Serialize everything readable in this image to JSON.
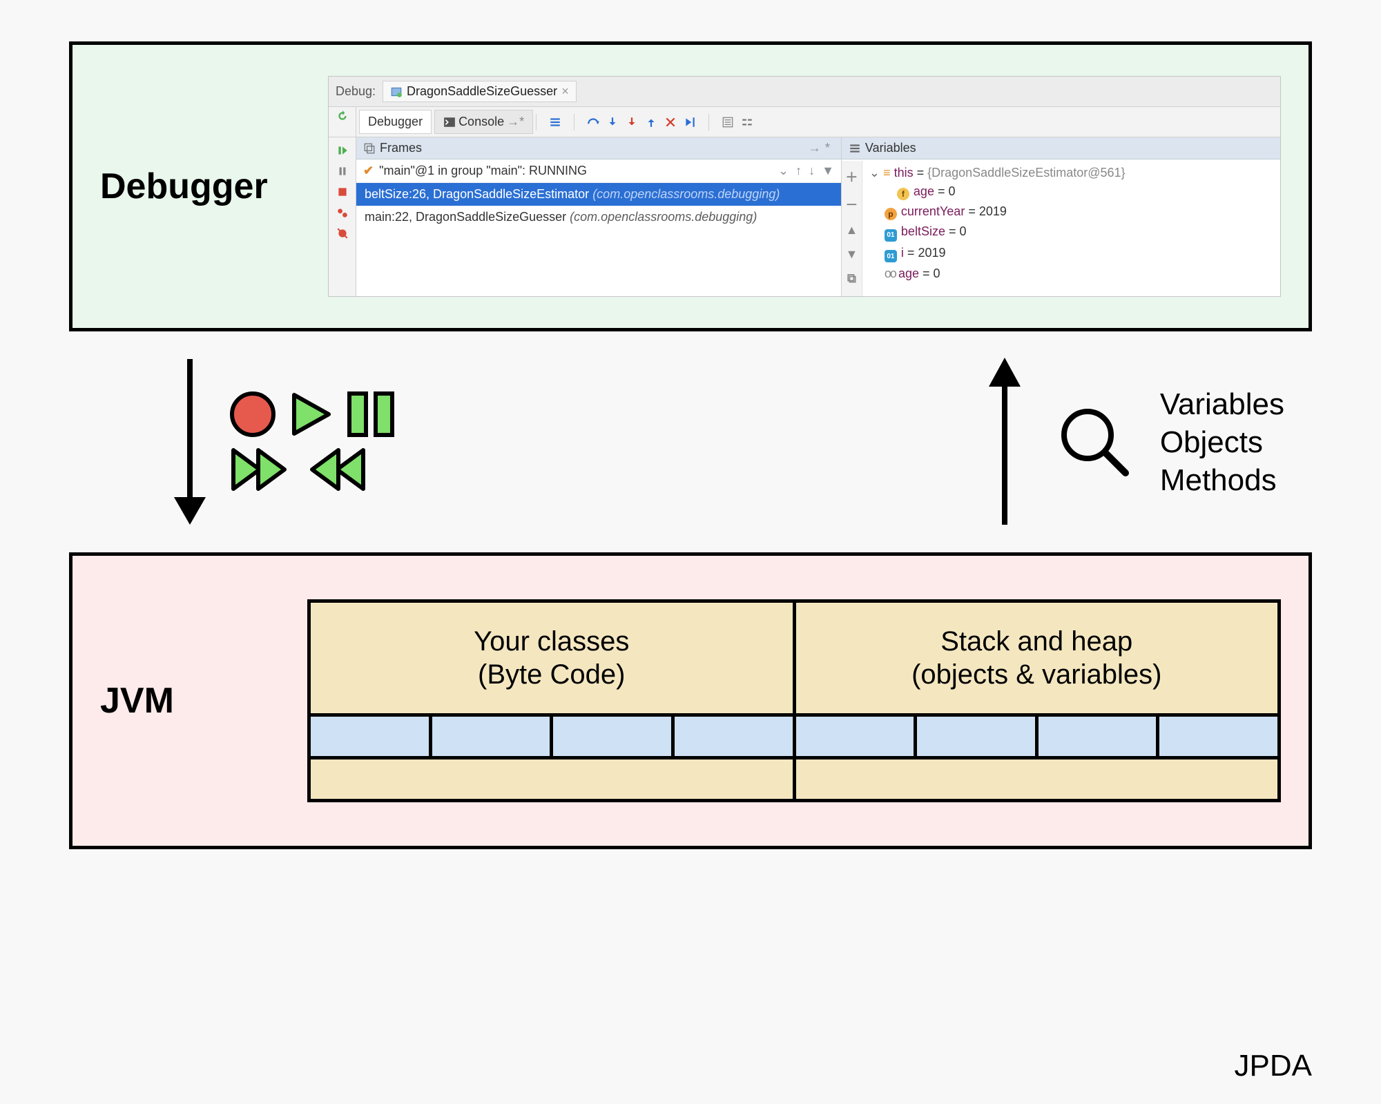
{
  "diagram": {
    "debugger_title": "Debugger",
    "jvm_title": "JVM",
    "footer": "JPDA"
  },
  "ide": {
    "debug_label": "Debug:",
    "run_config": "DragonSaddleSizeGuesser",
    "tabs": {
      "debugger": "Debugger",
      "console": "Console"
    },
    "frames_label": "Frames",
    "thread_status": "\"main\"@1 in group \"main\": RUNNING",
    "frames": [
      {
        "method": "beltSize",
        "line": 26,
        "cls": "DragonSaddleSizeEstimator",
        "pkg": "(com.openclassrooms.debugging)",
        "selected": true
      },
      {
        "method": "main",
        "line": 22,
        "cls": "DragonSaddleSizeGuesser",
        "pkg": "(com.openclassrooms.debugging)",
        "selected": false
      }
    ],
    "variables_label": "Variables",
    "variables": {
      "this_name": "this",
      "this_ref": "{DragonSaddleSizeEstimator@561}",
      "age": {
        "name": "age",
        "value": "0"
      },
      "currentYear": {
        "name": "currentYear",
        "value": "2019"
      },
      "beltSize": {
        "name": "beltSize",
        "value": "0"
      },
      "i": {
        "name": "i",
        "value": "2019"
      },
      "age2": {
        "name": "age",
        "value": "0"
      }
    }
  },
  "inspect": {
    "l1": "Variables",
    "l2": "Objects",
    "l3": "Methods"
  },
  "jvm_cells": {
    "left_l1": "Your classes",
    "left_l2": "(Byte Code)",
    "right_l1": "Stack and heap",
    "right_l2": "(objects & variables)"
  }
}
